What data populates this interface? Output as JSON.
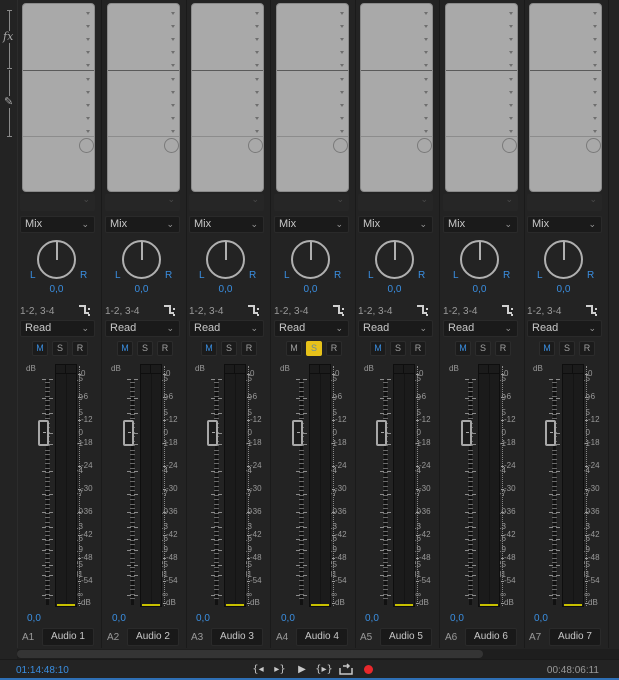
{
  "left_strip": {
    "fx_label": "fx",
    "sends_icon": "pen-icon"
  },
  "channels": [
    {
      "id": "A1",
      "name": "Audio 1",
      "fx_mode": "Mix",
      "pan_left": "L",
      "pan_right": "R",
      "pan_value": "0,0",
      "routing": "1-2, 3-4",
      "automation": "Read",
      "mute": "M",
      "solo": "S",
      "record": "R",
      "mute_active": true,
      "solo_active": false,
      "volume": "0,0"
    },
    {
      "id": "A2",
      "name": "Audio 2",
      "fx_mode": "Mix",
      "pan_left": "L",
      "pan_right": "R",
      "pan_value": "0,0",
      "routing": "1-2, 3-4",
      "automation": "Read",
      "mute": "M",
      "solo": "S",
      "record": "R",
      "mute_active": true,
      "solo_active": false,
      "volume": "0,0"
    },
    {
      "id": "A3",
      "name": "Audio 3",
      "fx_mode": "Mix",
      "pan_left": "L",
      "pan_right": "R",
      "pan_value": "0,0",
      "routing": "1-2, 3-4",
      "automation": "Read",
      "mute": "M",
      "solo": "S",
      "record": "R",
      "mute_active": true,
      "solo_active": false,
      "volume": "0,0"
    },
    {
      "id": "A4",
      "name": "Audio 4",
      "fx_mode": "Mix",
      "pan_left": "L",
      "pan_right": "R",
      "pan_value": "0,0",
      "routing": "1-2, 3-4",
      "automation": "Read",
      "mute": "M",
      "solo": "S",
      "record": "R",
      "mute_active": false,
      "solo_active": true,
      "volume": "0,0"
    },
    {
      "id": "A5",
      "name": "Audio 5",
      "fx_mode": "Mix",
      "pan_left": "L",
      "pan_right": "R",
      "pan_value": "0,0",
      "routing": "1-2, 3-4",
      "automation": "Read",
      "mute": "M",
      "solo": "S",
      "record": "R",
      "mute_active": true,
      "solo_active": false,
      "volume": "0,0"
    },
    {
      "id": "A6",
      "name": "Audio 6",
      "fx_mode": "Mix",
      "pan_left": "L",
      "pan_right": "R",
      "pan_value": "0,0",
      "routing": "1-2, 3-4",
      "automation": "Read",
      "mute": "M",
      "solo": "S",
      "record": "R",
      "mute_active": true,
      "solo_active": false,
      "volume": "0,0"
    },
    {
      "id": "A7",
      "name": "Audio 7",
      "fx_mode": "Mix",
      "pan_left": "L",
      "pan_right": "R",
      "pan_value": "0,0",
      "routing": "1-2, 3-4",
      "automation": "Read",
      "mute": "M",
      "solo": "S",
      "record": "R",
      "mute_active": true,
      "solo_active": false,
      "volume": "0,0"
    }
  ],
  "fader_scale": [
    "dB",
    "15",
    "9",
    "5",
    "0",
    "-1",
    "-4",
    "-7",
    "-10",
    "-13",
    "-16",
    "-19",
    "-25",
    "-31",
    "-∞"
  ],
  "meter_scale": [
    "0",
    "-6",
    "-12",
    "-18",
    "-24",
    "-30",
    "-36",
    "-42",
    "-48",
    "-54",
    "dB"
  ],
  "footer": {
    "timecode_current": "01:14:48:10",
    "timecode_duration": "00:48:06:11",
    "transport": [
      {
        "name": "go-to-in-button",
        "glyph": "{◂"
      },
      {
        "name": "go-to-out-button",
        "glyph": "▸}"
      },
      {
        "name": "play-button",
        "glyph": "▶"
      },
      {
        "name": "play-in-to-out-button",
        "glyph": "{▸}"
      },
      {
        "name": "loop-button",
        "glyph": "⮹"
      },
      {
        "name": "record-button",
        "glyph": ""
      }
    ]
  },
  "colors": {
    "accent": "#3a8ee0",
    "solo_active": "#e7c21a",
    "record": "#e8282c",
    "meter_level": "#c8c000"
  }
}
